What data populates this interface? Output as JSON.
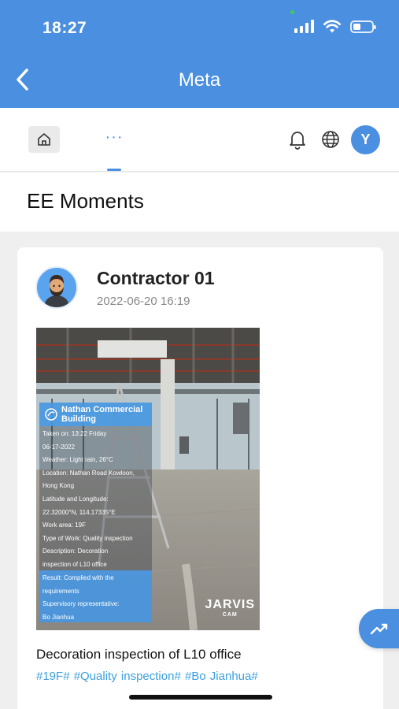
{
  "status_bar": {
    "time": "18:27",
    "battery_level": 0.4
  },
  "header": {
    "title": "Meta"
  },
  "nav": {
    "more_label": "···",
    "avatar_letter": "Y"
  },
  "section": {
    "title": "EE Moments"
  },
  "post": {
    "author": "Contractor 01",
    "datetime": "2022-06-20 16:19",
    "photo_overlay": {
      "project": "Nathan Commercial Building",
      "lines": [
        "Taken on: 13:22 Friday",
        "06-17-2022",
        "Weather: Light rain, 26°C",
        "Location: Nathan Road Kowloon,",
        "Hong Kong",
        "Latitude and Longitude:",
        "22.32000°N, 114.17335°E",
        "Work area: 19F",
        "Type of Work: Quality inspection",
        "Description: Decoration",
        "inspection of L10 office"
      ],
      "result_lines": [
        "Result:  Complied with the",
        "requirements",
        "Supervisory representative:",
        "Bo Jianhua"
      ],
      "watermark": "JARVIS",
      "watermark_sub": "CAM"
    },
    "caption": "Decoration inspection of L10 office",
    "tags": "#19F#  #Quality inspection# #Bo Jianhua#"
  },
  "colors": {
    "accent": "#4a8fe0",
    "tag": "#3aa0e0",
    "background": "#efefef"
  },
  "icons": [
    "back-arrow-icon",
    "home-icon",
    "bell-icon",
    "globe-icon",
    "trend-chart-icon",
    "wifi-icon",
    "signal-icon",
    "battery-icon"
  ]
}
